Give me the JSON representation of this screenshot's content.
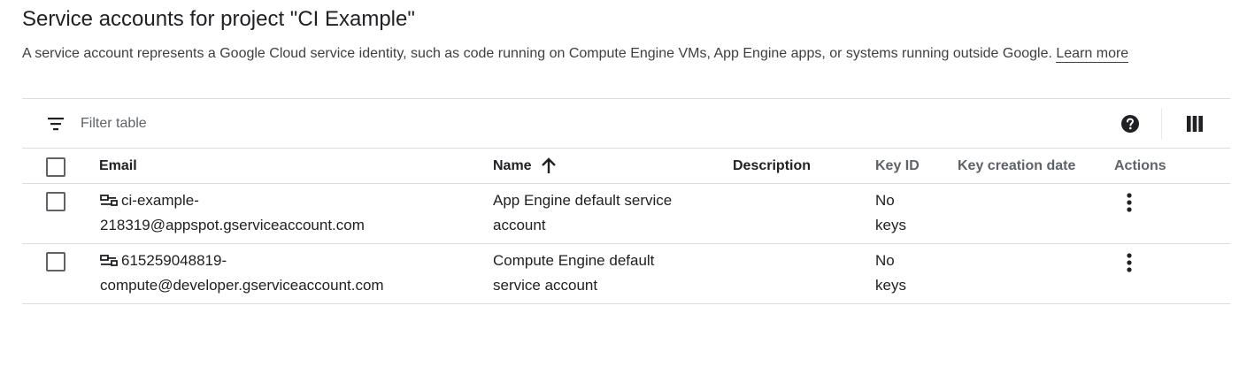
{
  "page": {
    "title": "Service accounts for project \"CI Example\"",
    "description": "A service account represents a Google Cloud service identity, such as code running on Compute Engine VMs, App Engine apps, or systems running outside Google.",
    "learn_more": "Learn more"
  },
  "toolbar": {
    "filter_placeholder": "Filter table",
    "filter_icon": "filter-list-icon",
    "help_icon": "help-circle-icon",
    "columns_icon": "column-display-icon"
  },
  "table": {
    "columns": {
      "email": "Email",
      "name": "Name",
      "description": "Description",
      "key_id": "Key ID",
      "key_creation_date": "Key creation date",
      "actions": "Actions"
    },
    "sort": {
      "column": "Name",
      "direction": "ascending",
      "icon": "arrow-upward-icon"
    },
    "rows": [
      {
        "email_line1": "ci-example-",
        "email_line2": "218319@appspot.gserviceaccount.com",
        "name_line1": "App Engine default service",
        "name_line2": "account",
        "description": "",
        "key_id_line1": "No",
        "key_id_line2": "keys",
        "key_creation_date": "",
        "icon": "service-account-key-icon",
        "action_icon": "more-vert-icon"
      },
      {
        "email_line1": "615259048819-",
        "email_line2": "compute@developer.gserviceaccount.com",
        "name_line1": "Compute Engine default",
        "name_line2": "service account",
        "description": "",
        "key_id_line1": "No",
        "key_id_line2": "keys",
        "key_creation_date": "",
        "icon": "service-account-key-icon",
        "action_icon": "more-vert-icon"
      }
    ]
  },
  "colors": {
    "text_primary": "#202124",
    "text_secondary": "#5f6368",
    "divider": "#dadce0"
  }
}
